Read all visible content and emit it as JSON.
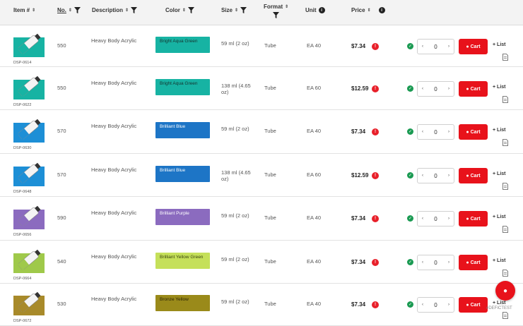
{
  "header": {
    "col_item": "Item #",
    "col_no": "No.",
    "col_description": "Description",
    "col_color": "Color",
    "col_size": "Size",
    "col_format": "Format",
    "col_unit": "Unit",
    "col_price": "Price"
  },
  "rows": [
    {
      "sku": "DSP-0614",
      "no": "550",
      "description": "Heavy Body Acrylic",
      "color_name": "Bright Aqua Green",
      "color_hex": "#17b3a3",
      "color_text": "#15332f",
      "size": "59 ml (2 oz)",
      "format": "Tube",
      "unit": "EA 40",
      "price": "$7.34",
      "qty": "0",
      "cart_label": "Cart",
      "list_label": "List",
      "tube_color": "#17b3a3"
    },
    {
      "sku": "DSP-0622",
      "no": "550",
      "description": "Heavy Body Acrylic",
      "color_name": "Bright Aqua Green",
      "color_hex": "#17b3a3",
      "color_text": "#15332f",
      "size": "138 ml (4.65 oz)",
      "format": "Tube",
      "unit": "EA 60",
      "price": "$12.59",
      "qty": "0",
      "cart_label": "Cart",
      "list_label": "List",
      "tube_color": "#17b3a3"
    },
    {
      "sku": "DSP-0630",
      "no": "570",
      "description": "Heavy Body Acrylic",
      "color_name": "Brilliant Blue",
      "color_hex": "#1d75c6",
      "color_text": "#ffffff",
      "size": "59 ml (2 oz)",
      "format": "Tube",
      "unit": "EA 40",
      "price": "$7.34",
      "qty": "0",
      "cart_label": "Cart",
      "list_label": "List",
      "tube_color": "#1d8fd6"
    },
    {
      "sku": "DSP-0648",
      "no": "570",
      "description": "Heavy Body Acrylic",
      "color_name": "Brilliant Blue",
      "color_hex": "#1d75c6",
      "color_text": "#ffffff",
      "size": "138 ml (4.65 oz)",
      "format": "Tube",
      "unit": "EA 60",
      "price": "$12.59",
      "qty": "0",
      "cart_label": "Cart",
      "list_label": "List",
      "tube_color": "#1d8fd6"
    },
    {
      "sku": "DSP-0656",
      "no": "590",
      "description": "Heavy Body Acrylic",
      "color_name": "Brilliant Purple",
      "color_hex": "#8b6bbf",
      "color_text": "#ffffff",
      "size": "59 ml (2 oz)",
      "format": "Tube",
      "unit": "EA 40",
      "price": "$7.34",
      "qty": "0",
      "cart_label": "Cart",
      "list_label": "List",
      "tube_color": "#8b6bbf"
    },
    {
      "sku": "DSP-0664",
      "no": "540",
      "description": "Heavy Body Acrylic",
      "color_name": "Brilliant Yellow Green",
      "color_hex": "#c5e05a",
      "color_text": "#3a4410",
      "size": "59 ml (2 oz)",
      "format": "Tube",
      "unit": "EA 40",
      "price": "$7.34",
      "qty": "0",
      "cart_label": "Cart",
      "list_label": "List",
      "tube_color": "#9fc94a"
    },
    {
      "sku": "DSP-0672",
      "no": "530",
      "description": "Heavy Body Acrylic",
      "color_name": "Bronze Yellow",
      "color_hex": "#9a8a1a",
      "color_text": "#2b2505",
      "size": "59 ml (2 oz)",
      "format": "Tube",
      "unit": "EA 40",
      "price": "$7.34",
      "qty": "0",
      "cart_label": "Cart",
      "list_label": "List",
      "tube_color": "#a88a2a"
    }
  ],
  "fab": {
    "icon": "pin-icon",
    "color": "#e8121b"
  },
  "watermark": "#DEFICTEST"
}
